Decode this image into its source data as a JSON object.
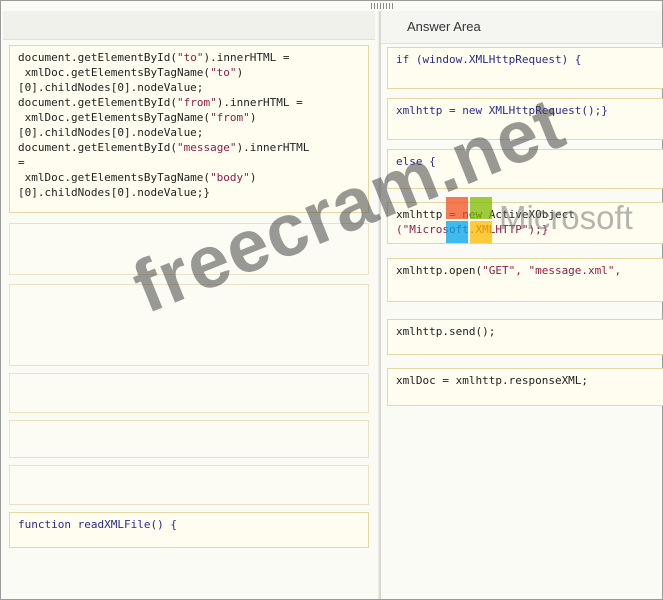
{
  "answer_area": {
    "title": "Answer Area"
  },
  "left_items": [
    {
      "lines": [
        [
          {
            "t": "document.getElementById("
          },
          {
            "t": "\"to\"",
            "c": "str"
          },
          {
            "t": ").innerHTML ="
          }
        ],
        [
          {
            "t": " xmlDoc.getElementsByTagName("
          },
          {
            "t": "\"to\"",
            "c": "str"
          },
          {
            "t": ")"
          }
        ],
        [
          {
            "t": "[0].childNodes[0].nodeValue;"
          }
        ],
        [
          {
            "t": "document.getElementById("
          },
          {
            "t": "\"from\"",
            "c": "str"
          },
          {
            "t": ").innerHTML ="
          }
        ],
        [
          {
            "t": " xmlDoc.getElementsByTagName("
          },
          {
            "t": "\"from\"",
            "c": "str"
          },
          {
            "t": ")"
          }
        ],
        [
          {
            "t": "[0].childNodes[0].nodeValue;"
          }
        ],
        [
          {
            "t": "document.getElementById("
          },
          {
            "t": "\"message\"",
            "c": "str"
          },
          {
            "t": ").innerHTML"
          }
        ],
        [
          {
            "t": "="
          }
        ],
        [
          {
            "t": " xmlDoc.getElementsByTagName("
          },
          {
            "t": "\"body\"",
            "c": "str"
          },
          {
            "t": ")"
          }
        ],
        [
          {
            "t": "[0].childNodes[0].nodeValue;}"
          }
        ]
      ]
    },
    {
      "lines": []
    },
    {
      "lines": []
    },
    {
      "lines": []
    },
    {
      "lines": []
    },
    {
      "lines": []
    },
    {
      "lines": [
        [
          {
            "t": "function readXMLFile() {",
            "c": "kw"
          }
        ]
      ]
    }
  ],
  "right_items": [
    {
      "lines": [
        [
          {
            "t": "if (window.XMLHttpRequest) {",
            "c": "kw"
          }
        ]
      ]
    },
    {
      "lines": [
        [
          {
            "t": "xmlhttp = new XMLHttpRequest();}",
            "c": "kw"
          }
        ]
      ]
    },
    {
      "lines": [
        [
          {
            "t": "else {",
            "c": "kw"
          }
        ]
      ]
    },
    {
      "lines": [
        [
          {
            "t": "xmlhttp = new ActiveXObject"
          }
        ],
        [
          {
            "t": "(\"Microsoft.XMLHTTP\");}",
            "c": "str"
          }
        ]
      ]
    },
    {
      "lines": [
        [
          {
            "t": "xmlhttp.open("
          },
          {
            "t": "\"GET\", \"message.xml\",",
            "c": "str"
          }
        ]
      ]
    },
    {
      "lines": [
        [
          {
            "t": "xmlhttp.send();"
          }
        ]
      ]
    },
    {
      "lines": [
        [
          {
            "t": "xmlDoc = xmlhttp.responseXML;"
          }
        ]
      ]
    }
  ],
  "watermark": {
    "text": "freecram.net",
    "brand": "Microsoft"
  },
  "colors": {
    "box_border": "#e6d6a2",
    "box_bg": "#fffdf0",
    "string": "#8b1f4a"
  }
}
